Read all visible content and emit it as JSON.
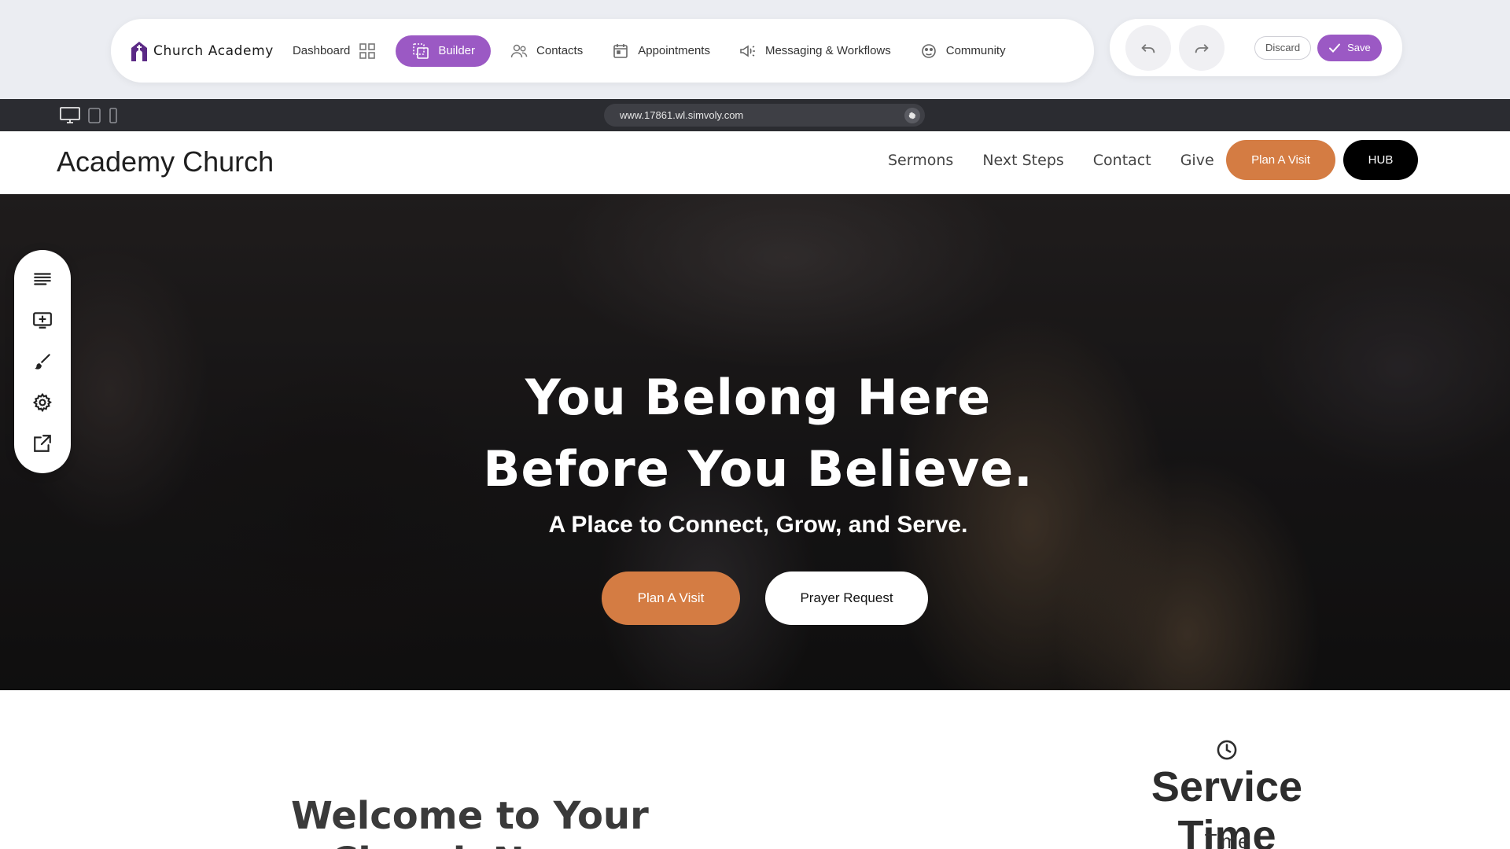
{
  "app": {
    "brand": "Church Academy",
    "nav": [
      {
        "label": "Dashboard",
        "icon": "grid-icon"
      },
      {
        "label": "Builder",
        "icon": "builder-icon",
        "active": true
      },
      {
        "label": "Contacts",
        "icon": "users-icon"
      },
      {
        "label": "Appointments",
        "icon": "calendar-icon"
      },
      {
        "label": "Messaging & Workflows",
        "icon": "megaphone-icon"
      },
      {
        "label": "Community",
        "icon": "community-icon"
      }
    ],
    "actions": {
      "undo_icon": "undo-icon",
      "redo_icon": "redo-icon",
      "discard": "Discard",
      "save": "Save"
    },
    "accent": "#9b59c4"
  },
  "preview": {
    "url": "www.17861.wl.simvoly.com",
    "devices": [
      "desktop-icon",
      "tablet-icon",
      "mobile-icon"
    ]
  },
  "site": {
    "title": "Academy Church",
    "nav": [
      "Sermons",
      "Next Steps",
      "Contact",
      "Give"
    ],
    "cta": "Plan A Visit",
    "hub": "HUB",
    "accent": "#d47c43"
  },
  "hero": {
    "line1": "You Belong Here",
    "line2": "Before You Believe.",
    "subtitle": "A Place to Connect, Grow, and Serve.",
    "primary_button": "Plan A Visit",
    "secondary_button": "Prayer Request"
  },
  "tools": [
    "layers-icon",
    "add-section-icon",
    "brush-icon",
    "gear-icon",
    "external-link-icon"
  ],
  "below": {
    "welcome_line1": "Welcome to Your",
    "welcome_line2": "Church Name",
    "service_title": "Service Time",
    "service_label": "Time"
  }
}
